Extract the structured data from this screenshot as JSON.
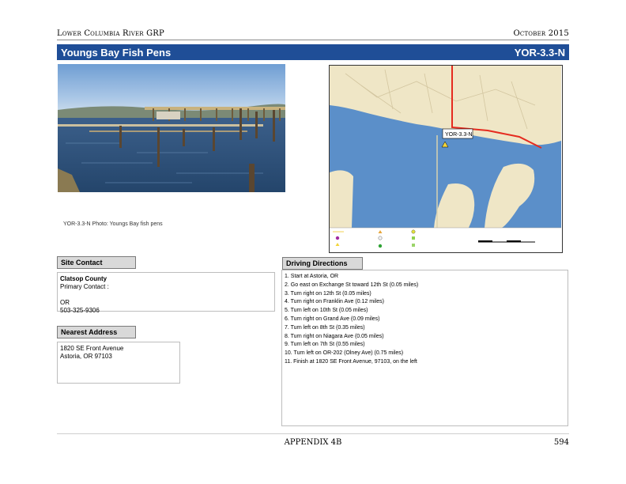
{
  "header": {
    "org": "Lower Columbia River GRP",
    "date": "October 2015"
  },
  "title": {
    "name": "Youngs Bay Fish Pens",
    "code": "YOR-3.3-N"
  },
  "photo": {
    "caption": "YOR-3.3-N Photo: Youngs Bay fish pens"
  },
  "map": {
    "site_label": "YOR-3.3-N"
  },
  "site_contact": {
    "heading": "Site Contact",
    "org": "Clatsop County",
    "primary": "Primary Contact :",
    "blank": "",
    "state": "OR",
    "phone": "503-325-9306"
  },
  "nearest_address": {
    "heading": "Nearest Address",
    "line1": "1820 SE Front Avenue",
    "line2": "Astoria, OR  97103"
  },
  "driving_directions": {
    "heading": "Driving Directions",
    "steps": [
      "1. Start at Astoria, OR",
      "2. Go east on Exchange St toward 12th St (0.05 miles)",
      "3. Turn right on 12th St (0.05 miles)",
      "4. Turn right on Franklin Ave (0.12 miles)",
      "5. Turn left on 10th St (0.05 miles)",
      "6. Turn right on Grand Ave (0.09 miles)",
      "7. Turn left on 8th St (0.35 miles)",
      "8. Turn right on Niagara Ave (0.05 miles)",
      "9. Turn left on 7th St (0.55 miles)",
      "10. Turn left on OR-202 (Olney Ave) (0.75 miles)",
      "11. Finish at 1820 SE Front Avenue, 97103, on the left"
    ]
  },
  "footer": {
    "appendix": "APPENDIX 4B",
    "page": "594"
  },
  "colors": {
    "title_bar": "#1f4e97",
    "water": "#5b8fc9",
    "land": "#efe6c6",
    "route": "#e52b1f"
  }
}
